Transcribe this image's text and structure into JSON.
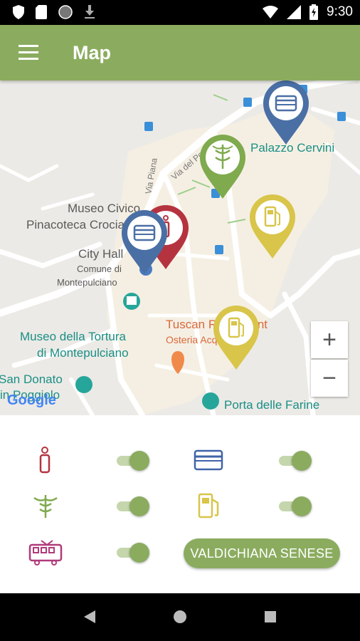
{
  "status_bar": {
    "time": "9:30",
    "left_icons": [
      "shield-icon",
      "sim-card-icon",
      "circle-icon",
      "download-icon"
    ],
    "right_icons": [
      "wifi-icon",
      "signal-icon",
      "battery-icon"
    ]
  },
  "app_bar": {
    "title": "Map",
    "menu_icon": "hamburger-menu-icon",
    "color": "#8bac5f"
  },
  "map": {
    "labels": {
      "palazzo": "Palazzo Cervini",
      "museo_civico_1": "Museo Civico",
      "museo_civico_2": "Pinacoteca Crociani",
      "city_hall": "City Hall",
      "comune_1": "Comune di",
      "comune_2": "Montepulciano",
      "tortura_1": "Museo della Tortura",
      "tortura_2": "di Montepulciano",
      "tuscan": "Tuscan Restaurant",
      "osteria": "Osteria Acquacheta",
      "san_donato_1": "San Donato",
      "san_donato_2": "in Poggiolo",
      "porta": "Porta delle Farine",
      "via_piana": "Via Piana",
      "via_poggiolo": "Via del Poggiolo",
      "google": "Google"
    },
    "zoom_in": "+",
    "zoom_out": "−",
    "markers": [
      {
        "type": "card",
        "color": "#4a6fa5"
      },
      {
        "type": "pharmacy",
        "color": "#7faa4e"
      },
      {
        "type": "fuel",
        "color": "#d8c54a"
      },
      {
        "type": "info",
        "color": "#b5333f"
      },
      {
        "type": "card",
        "color": "#4a6fa5"
      },
      {
        "type": "fuel",
        "color": "#d8c54a"
      }
    ]
  },
  "filters": [
    {
      "category": "info",
      "icon": "info-icon",
      "color": "#b5333f",
      "enabled": true
    },
    {
      "category": "atm",
      "icon": "credit-card-icon",
      "color": "#3f63a8",
      "enabled": true
    },
    {
      "category": "pharmacy",
      "icon": "caduceus-icon",
      "color": "#7faa4e",
      "enabled": true
    },
    {
      "category": "fuel",
      "icon": "fuel-pump-icon",
      "color": "#d8c54a",
      "enabled": true
    },
    {
      "category": "transport",
      "icon": "tram-icon",
      "color": "#b03a7a",
      "enabled": true
    }
  ],
  "region_button": {
    "label": "VALDICHIANA SENESE"
  },
  "nav_bar": {
    "buttons": [
      "back-icon",
      "home-icon",
      "recents-icon"
    ]
  }
}
